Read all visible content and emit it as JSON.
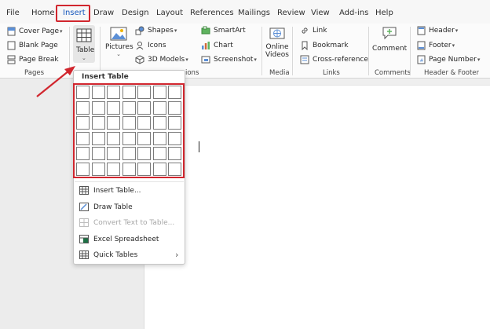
{
  "tabs": [
    "File",
    "Home",
    "Insert",
    "Draw",
    "Design",
    "Layout",
    "References",
    "Mailings",
    "Review",
    "View",
    "Add-ins",
    "Help"
  ],
  "active_tab": "Insert",
  "ribbon": {
    "pages": {
      "cover_page": "Cover Page",
      "blank_page": "Blank Page",
      "page_break": "Page Break",
      "group": "Pages"
    },
    "tables": {
      "table": "Table"
    },
    "illustrations": {
      "pictures": "Pictures",
      "shapes": "Shapes",
      "icons": "Icons",
      "models_3d": "3D Models",
      "smartart": "SmartArt",
      "chart": "Chart",
      "screenshot": "Screenshot",
      "group_partial": "ions"
    },
    "media": {
      "online": "Online",
      "videos": "Videos",
      "group": "Media"
    },
    "links": {
      "link": "Link",
      "bookmark": "Bookmark",
      "cross_reference": "Cross-reference",
      "group": "Links"
    },
    "comments": {
      "comment": "Comment",
      "group": "Comments"
    },
    "header_footer": {
      "header": "Header",
      "footer": "Footer",
      "page_number": "Page Number",
      "group": "Header & Footer"
    }
  },
  "dropdown": {
    "title": "Insert Table",
    "grid": {
      "columns": 7,
      "rows": 6
    },
    "items": [
      {
        "label": "Insert Table...",
        "disabled": false
      },
      {
        "label": "Draw Table",
        "disabled": false
      },
      {
        "label": "Convert Text to Table...",
        "disabled": true
      },
      {
        "label": "Excel Spreadsheet",
        "disabled": false
      },
      {
        "label": "Quick Tables",
        "disabled": false
      }
    ]
  },
  "colors": {
    "highlight": "#d1262e",
    "accent": "#185abd",
    "excel": "#1e7145"
  },
  "icons": [
    "page-icon",
    "table-icon",
    "pictures-icon",
    "shapes-icon",
    "icons-icon",
    "3d-models-icon",
    "smartart-icon",
    "chart-icon",
    "screenshot-icon",
    "online-videos-icon",
    "link-icon",
    "bookmark-icon",
    "cross-reference-icon",
    "comment-icon",
    "header-icon",
    "footer-icon",
    "page-number-icon",
    "excel-icon"
  ]
}
